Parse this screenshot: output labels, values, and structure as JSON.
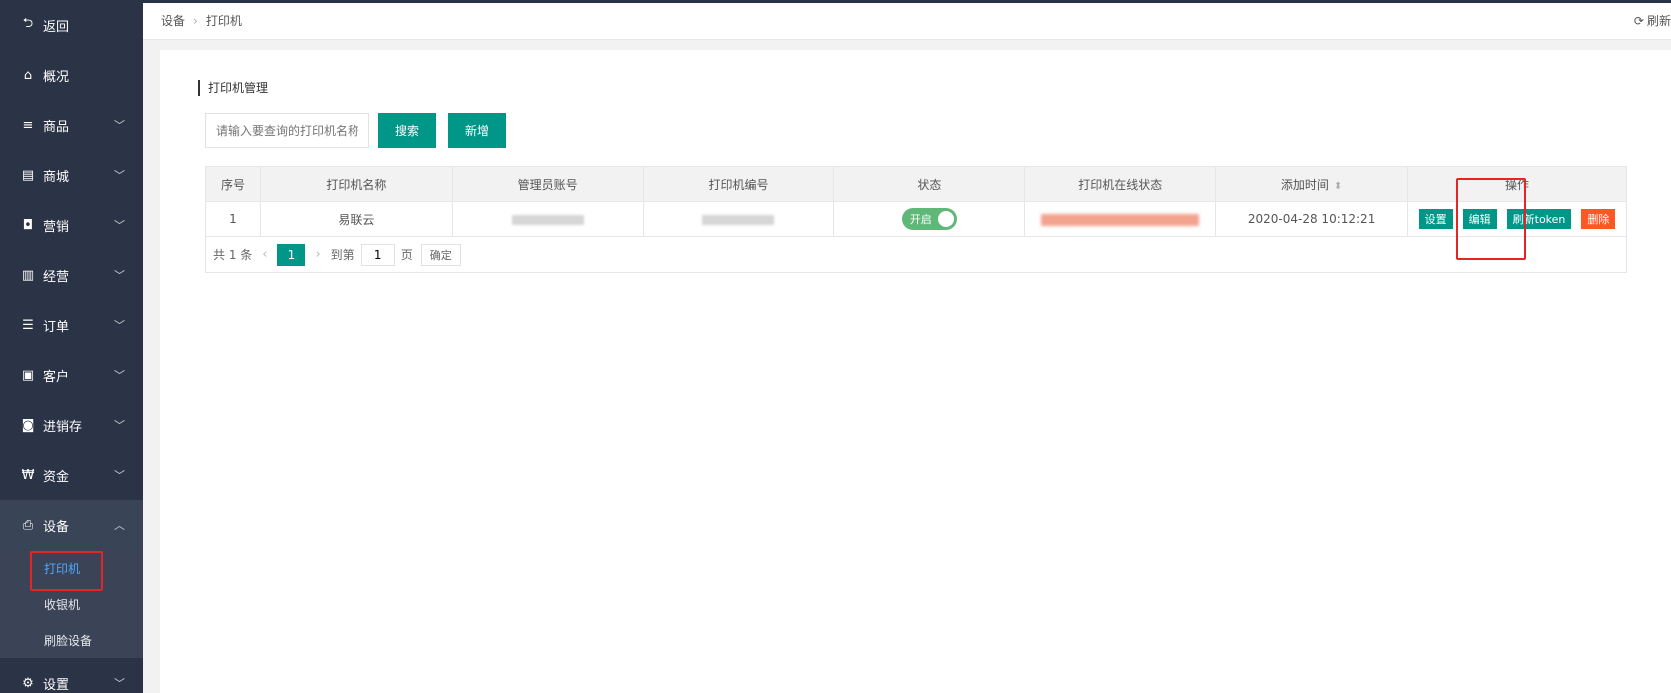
{
  "sidebar": {
    "items": [
      {
        "label": "返回",
        "icon": "back-arrow-icon",
        "glyph": "⮌",
        "chevron": false
      },
      {
        "label": "概况",
        "icon": "home-icon",
        "glyph": "⌂",
        "chevron": false
      },
      {
        "label": "商品",
        "icon": "menu-icon",
        "glyph": "≡",
        "chevron": true
      },
      {
        "label": "商城",
        "icon": "shop-bag-icon",
        "glyph": "▤",
        "chevron": true
      },
      {
        "label": "营销",
        "icon": "gift-icon",
        "glyph": "◘",
        "chevron": true
      },
      {
        "label": "经营",
        "icon": "bar-chart-icon",
        "glyph": "▥",
        "chevron": true
      },
      {
        "label": "订单",
        "icon": "list-icon",
        "glyph": "☰",
        "chevron": true
      },
      {
        "label": "客户",
        "icon": "id-card-icon",
        "glyph": "▣",
        "chevron": true
      },
      {
        "label": "进销存",
        "icon": "truck-icon",
        "glyph": "◙",
        "chevron": true
      },
      {
        "label": "资金",
        "icon": "currency-icon",
        "glyph": "₩",
        "chevron": true
      },
      {
        "label": "设备",
        "icon": "printer-icon",
        "glyph": "⎙",
        "chevron": true,
        "expanded": true
      }
    ],
    "device_sub": [
      "打印机",
      "收银机",
      "刷脸设备"
    ],
    "settings": {
      "label": "设置",
      "icon": "gear-icon",
      "glyph": "⚙"
    }
  },
  "breadcrumb": [
    "设备",
    "打印机"
  ],
  "refresh_label": "刷新",
  "section_title": "打印机管理",
  "search": {
    "placeholder": "请输入要查询的打印机名称",
    "button": "搜索"
  },
  "add_button": "新增",
  "table": {
    "headers": [
      "序号",
      "打印机名称",
      "管理员账号",
      "打印机编号",
      "状态",
      "打印机在线状态",
      "添加时间",
      "操作"
    ],
    "rows": [
      {
        "index": "1",
        "name": "易联云",
        "status": "开启",
        "added": "2020-04-28 10:12:21",
        "ops": [
          "设置",
          "编辑",
          "刷新token",
          "删除"
        ]
      }
    ]
  },
  "pager": {
    "total": "共 1 条",
    "current": "1",
    "goto": "到第",
    "goto_value": "1",
    "page_unit": "页",
    "confirm": "确定"
  },
  "colors": {
    "sidebar": "#2b3446",
    "primary": "#009688",
    "danger": "#ff5722",
    "switch_on": "#5fb878",
    "highlight": "#e32525"
  }
}
